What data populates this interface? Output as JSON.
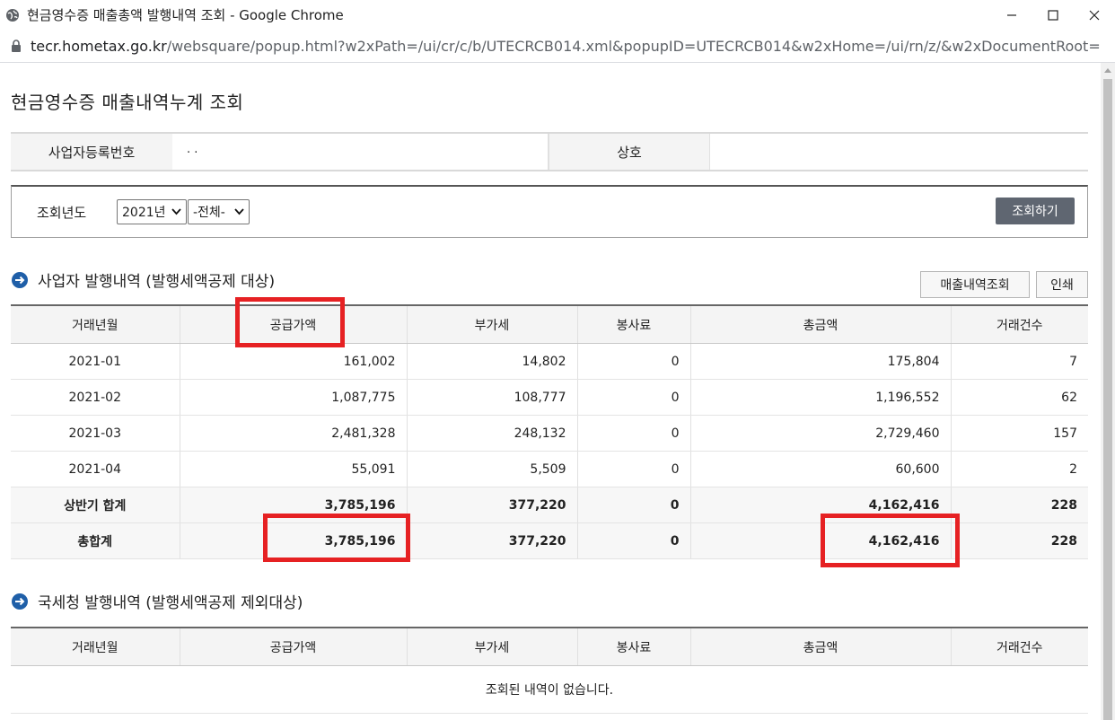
{
  "window": {
    "title": "현금영수증 매출총액 발행내역 조회 - Google Chrome",
    "url_host": "tecr.hometax.go.kr",
    "url_rest": "/websquare/popup.html?w2xPath=/ui/cr/c/b/UTECRCB014.xml&popupID=UTECRCB014&w2xHome=/ui/rn/z/&w2xDocumentRoot="
  },
  "page": {
    "title": "현금영수증 매출내역누계 조회"
  },
  "info": {
    "biz_no_label": "사업자등록번호",
    "biz_no_value": ".        .",
    "company_label": "상호",
    "company_value": ""
  },
  "search": {
    "year_label": "조회년도",
    "year_value": "2021년",
    "period_value": "-전체-",
    "submit_label": "조회하기"
  },
  "section1": {
    "title": "사업자 발행내역 (발행세액공제 대상)",
    "sales_button": "매출내역조회",
    "print_button": "인쇄",
    "headers": [
      "거래년월",
      "공급가액",
      "부가세",
      "봉사료",
      "총금액",
      "거래건수"
    ],
    "rows": [
      [
        "2021-01",
        "161,002",
        "14,802",
        "0",
        "175,804",
        "7"
      ],
      [
        "2021-02",
        "1,087,775",
        "108,777",
        "0",
        "1,196,552",
        "62"
      ],
      [
        "2021-03",
        "2,481,328",
        "248,132",
        "0",
        "2,729,460",
        "157"
      ],
      [
        "2021-04",
        "55,091",
        "5,509",
        "0",
        "60,600",
        "2"
      ]
    ],
    "subtotal": [
      "상반기 합계",
      "3,785,196",
      "377,220",
      "0",
      "4,162,416",
      "228"
    ],
    "total": [
      "총합계",
      "3,785,196",
      "377,220",
      "0",
      "4,162,416",
      "228"
    ]
  },
  "section2": {
    "title": "국세청 발행내역 (발행세액공제 제외대상)",
    "headers": [
      "거래년월",
      "공급가액",
      "부가세",
      "봉사료",
      "총금액",
      "거래건수"
    ],
    "empty_message": "조회된 내역이 없습니다."
  },
  "colors": {
    "highlight": "#e62123",
    "button_dark": "#5f6671",
    "header_bg": "#f4f4f4"
  }
}
